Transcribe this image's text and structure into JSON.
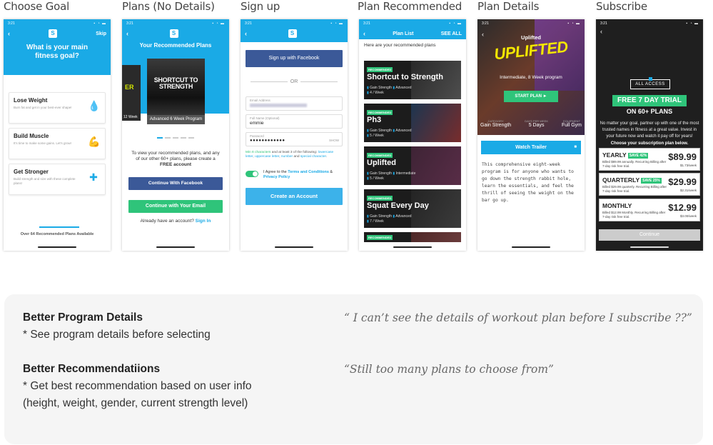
{
  "columns": [
    "Choose Goal",
    "Plans (No Details)",
    "Sign up",
    "Plan Recommended",
    "Plan Details",
    "Subscribe"
  ],
  "status_time": "3:21",
  "brand_logo": "S",
  "screen1": {
    "skip": "Skip",
    "question": "What is your main fitness goal?",
    "goals": [
      {
        "title": "Lose Weight",
        "sub": "Burn fat and get in your best-ever shape!",
        "icon": "drop-icon"
      },
      {
        "title": "Build Muscle",
        "sub": "It's time to make some gains. Let's grow!",
        "icon": "flex-arm-icon"
      },
      {
        "title": "Get Stronger",
        "sub": "Build strength and size with these complete plans!",
        "icon": "dumbbell-icon"
      }
    ],
    "footer": "Over 64 Recommended Plans Available"
  },
  "screen2": {
    "title": "Your Recommended Plans",
    "left_tile": "12 Week",
    "plan_art": "SHORTCUT TO STRENGTH",
    "plan_caption": "Advanced 6 Week Program",
    "message_1": "To view your recommended plans, and any of our other 60+ plans, please create a",
    "message_bold": "FREE account",
    "fb_button": "Continue With Facebook",
    "email_button": "Continue with Your Email",
    "already": "Already have an account?",
    "signin": "Sign In"
  },
  "screen3": {
    "fb_button": "Sign up with Facebook",
    "or": "OR",
    "email_label": "Email Address",
    "name_label": "Full Name (Optional)",
    "name_value": "emmie",
    "password_label": "Password",
    "password_value": "●●●●●●●●●●●●",
    "show": "SHOW",
    "hint_a": "Min 8 characters",
    "hint_b": " and at least 3 of the following: ",
    "hint_c": "lowercase letter",
    "hint_d": ", ",
    "hint_e": "uppercase letter",
    "hint_f": ", ",
    "hint_g": "number",
    "hint_h": " and ",
    "hint_i": "special character",
    "hint_j": ".",
    "agree_a": "I Agree to the ",
    "agree_terms": "Terms and Conditions",
    "agree_and": " & ",
    "agree_privacy": "Privacy Policy",
    "create": "Create an Account"
  },
  "screen4": {
    "nav_title": "Plan List",
    "see_all": "SEE ALL",
    "subtitle": "Here are your recommended plans",
    "badge": "RECOMMENDED",
    "plans": [
      {
        "name": "Shortcut to Strength",
        "goal": "Gain Strength",
        "level": "Advanced",
        "freq": "4 / Week"
      },
      {
        "name": "Ph3",
        "goal": "Gain Strength",
        "level": "Advanced",
        "freq": "5 / Week"
      },
      {
        "name": "Uplifted",
        "goal": "Gain Strength",
        "level": "Intermediate",
        "freq": "5 / Week"
      },
      {
        "name": "Squat Every Day",
        "goal": "Gain Strength",
        "level": "Advanced",
        "freq": "7 / Week"
      }
    ]
  },
  "screen5": {
    "name": "Uplifted",
    "logo": "UPLIFTED",
    "desc": "Intermediate, 8 Week program",
    "start": "START PLAN ►",
    "stats": [
      {
        "label": "CATEGORY",
        "value": "Gain Strength"
      },
      {
        "label": "DAYS PER WEEK",
        "value": "5 Days"
      },
      {
        "label": "EQUIPMENT",
        "value": "Full Gym"
      }
    ],
    "trailer": "Watch Trailer",
    "body": "This comprehensive eight-week program is for anyone who wants to go down the strength rabbit hole, learn the essentials, and feel the thrill of seeing the weight on the bar go up."
  },
  "screen6": {
    "badge": "ALL ACCESS",
    "trial": "FREE 7 DAY TRIAL",
    "on60": "ON 60+ PLANS",
    "text": "No matter your goal, partner up with one of the most trusted names in fitness at a great value. Invest in your future now and watch it pay off for years!",
    "text_bold": "Choose your subscription plan below.",
    "plans": [
      {
        "name": "YEARLY",
        "save": "SAVE 42%",
        "note": "Billed $89.99 annually. Recurring Billing after 7-day risk free trial.",
        "price": "$89.99",
        "week": "$1.73/week"
      },
      {
        "name": "QUARTERLY",
        "save": "SAVE 25%",
        "note": "Billed $29.99 quarterly. Recurring Billing after 7-day risk free trial.",
        "price": "$29.99",
        "week": "$2.31/week"
      },
      {
        "name": "MONTHLY",
        "save": "",
        "note": "Billed $12.99 Monthly. Recurring Billing after 7-day risk free trial.",
        "price": "$12.99",
        "week": "$3.00/week"
      }
    ],
    "continue": "Continue"
  },
  "notes": {
    "h1": "Better Program Details",
    "b1": "* See program details before selecting",
    "q1": "“ I can’t see the details of workout plan before I subscribe ??”",
    "h2": "Better Recommendatiions",
    "b2a": "* Get best recommendation based on user info",
    "b2b": "(height, weight, gender, current strength level)",
    "q2": "“Still too many plans to choose from”"
  }
}
